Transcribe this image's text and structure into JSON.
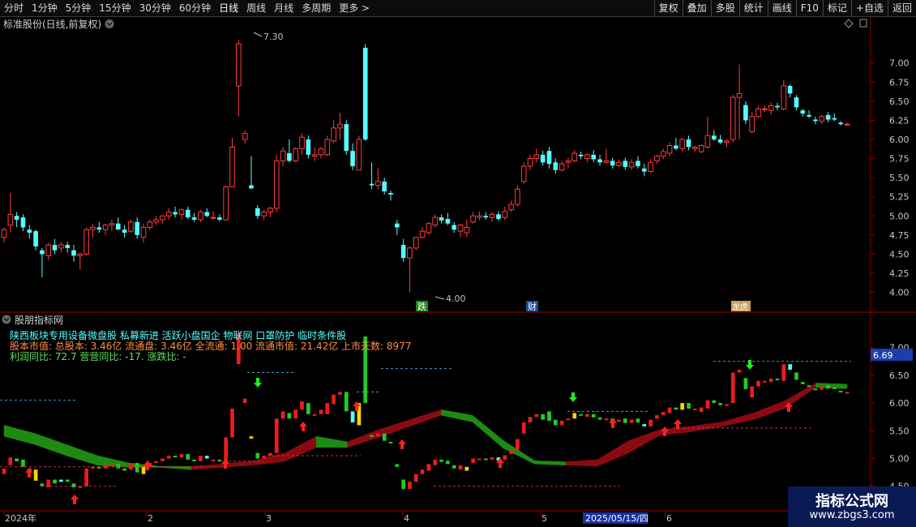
{
  "toolbar": {
    "periods": [
      "分时",
      "1分钟",
      "5分钟",
      "15分钟",
      "30分钟",
      "60分钟",
      "日线",
      "周线",
      "月线",
      "多周期",
      "更多 >"
    ],
    "active": "日线",
    "right_buttons": [
      "复权",
      "叠加",
      "多股",
      "统计",
      "画线",
      "F10",
      "标记",
      "+自选",
      "返回"
    ]
  },
  "main_panel": {
    "title": "标准股份(日线,前复权)",
    "high_label": "7.30",
    "low_label": "4.00",
    "markers": [
      "跌",
      "财",
      "龙虎"
    ],
    "y_ticks": [
      "7.00",
      "6.75",
      "6.50",
      "6.25",
      "6.00",
      "5.75",
      "5.50",
      "5.25",
      "5.00",
      "4.75",
      "4.50",
      "4.25",
      "4.00"
    ]
  },
  "indicator_panel": {
    "title": "股朋指标网",
    "line1": "陕西板块专用设备微盘股 私募新进 活跃小盘国企 物联网 口罩防护 临时条件股",
    "line2": "股本市值: 总股本: 3.46亿 流通盘: 3.46亿 全流通: 1.00 流通市值: 21.42亿 上市天数: 8977",
    "line3": "利润同比: 72.7 营营同比: -17. 涨跌比: -",
    "current_value": "6.69",
    "y_ticks": [
      "7.00",
      "6.50",
      "6.00",
      "5.50",
      "5.00",
      "4.50"
    ]
  },
  "x_axis": {
    "labels": [
      "2024年",
      "2",
      "3",
      "4",
      "5",
      "6"
    ],
    "cursor_date": "2025/05/15/四"
  },
  "watermark": {
    "title": "指标公式网",
    "url": "www.zbgs3.com"
  },
  "colors": {
    "up": "#ff3c3c",
    "down": "#54ffff",
    "bg": "#000000",
    "axis": "#8b0000"
  },
  "chart_data": {
    "type": "candlestick",
    "ylim": [
      3.9,
      7.4
    ],
    "candles": [
      {
        "o": 4.72,
        "h": 4.85,
        "l": 4.65,
        "c": 4.82
      },
      {
        "o": 4.88,
        "h": 5.3,
        "l": 4.78,
        "c": 5.02
      },
      {
        "o": 5.0,
        "h": 5.05,
        "l": 4.85,
        "c": 4.95
      },
      {
        "o": 4.98,
        "h": 5.02,
        "l": 4.8,
        "c": 4.85
      },
      {
        "o": 4.82,
        "h": 4.88,
        "l": 4.7,
        "c": 4.78
      },
      {
        "o": 4.8,
        "h": 4.82,
        "l": 4.55,
        "c": 4.6
      },
      {
        "o": 4.55,
        "h": 4.58,
        "l": 4.2,
        "c": 4.5
      },
      {
        "o": 4.48,
        "h": 4.65,
        "l": 4.42,
        "c": 4.62
      },
      {
        "o": 4.62,
        "h": 4.7,
        "l": 4.5,
        "c": 4.55
      },
      {
        "o": 4.58,
        "h": 4.66,
        "l": 4.52,
        "c": 4.62
      },
      {
        "o": 4.62,
        "h": 4.66,
        "l": 4.52,
        "c": 4.58
      },
      {
        "o": 4.55,
        "h": 4.62,
        "l": 4.4,
        "c": 4.48
      },
      {
        "o": 4.48,
        "h": 4.52,
        "l": 4.3,
        "c": 4.5
      },
      {
        "o": 4.5,
        "h": 4.85,
        "l": 4.48,
        "c": 4.82
      },
      {
        "o": 4.82,
        "h": 4.9,
        "l": 4.72,
        "c": 4.85
      },
      {
        "o": 4.85,
        "h": 4.92,
        "l": 4.78,
        "c": 4.82
      },
      {
        "o": 4.82,
        "h": 4.9,
        "l": 4.75,
        "c": 4.88
      },
      {
        "o": 4.88,
        "h": 4.95,
        "l": 4.8,
        "c": 4.9
      },
      {
        "o": 4.9,
        "h": 4.98,
        "l": 4.85,
        "c": 4.82
      },
      {
        "o": 4.82,
        "h": 4.88,
        "l": 4.72,
        "c": 4.78
      },
      {
        "o": 4.8,
        "h": 4.95,
        "l": 4.78,
        "c": 4.92
      },
      {
        "o": 4.92,
        "h": 4.98,
        "l": 4.7,
        "c": 4.75
      },
      {
        "o": 4.72,
        "h": 4.9,
        "l": 4.65,
        "c": 4.85
      },
      {
        "o": 4.85,
        "h": 4.95,
        "l": 4.82,
        "c": 4.92
      },
      {
        "o": 4.92,
        "h": 5.0,
        "l": 4.88,
        "c": 4.95
      },
      {
        "o": 4.95,
        "h": 5.0,
        "l": 4.9,
        "c": 5.0
      },
      {
        "o": 5.0,
        "h": 5.1,
        "l": 4.95,
        "c": 5.05
      },
      {
        "o": 5.05,
        "h": 5.12,
        "l": 4.98,
        "c": 5.02
      },
      {
        "o": 5.02,
        "h": 5.1,
        "l": 4.95,
        "c": 5.08
      },
      {
        "o": 5.08,
        "h": 5.12,
        "l": 4.96,
        "c": 4.98
      },
      {
        "o": 4.98,
        "h": 5.04,
        "l": 4.92,
        "c": 4.95
      },
      {
        "o": 4.95,
        "h": 5.08,
        "l": 4.92,
        "c": 5.05
      },
      {
        "o": 5.05,
        "h": 5.1,
        "l": 4.98,
        "c": 5.0
      },
      {
        "o": 4.98,
        "h": 5.06,
        "l": 4.94,
        "c": 4.98
      },
      {
        "o": 4.98,
        "h": 5.02,
        "l": 4.93,
        "c": 4.95
      },
      {
        "o": 4.95,
        "h": 5.4,
        "l": 4.93,
        "c": 5.38
      },
      {
        "o": 5.38,
        "h": 6.02,
        "l": 5.38,
        "c": 5.9
      },
      {
        "o": 6.7,
        "h": 7.3,
        "l": 6.3,
        "c": 7.25
      },
      {
        "o": 6.0,
        "h": 6.12,
        "l": 5.95,
        "c": 6.08
      },
      {
        "o": 5.4,
        "h": 5.78,
        "l": 5.35,
        "c": 5.36
      },
      {
        "o": 5.1,
        "h": 5.14,
        "l": 4.96,
        "c": 5.0
      },
      {
        "o": 5.0,
        "h": 5.08,
        "l": 4.95,
        "c": 5.05
      },
      {
        "o": 5.05,
        "h": 5.12,
        "l": 4.98,
        "c": 5.1
      },
      {
        "o": 5.1,
        "h": 5.8,
        "l": 5.05,
        "c": 5.72
      },
      {
        "o": 5.72,
        "h": 5.9,
        "l": 5.65,
        "c": 5.85
      },
      {
        "o": 5.82,
        "h": 6.0,
        "l": 5.7,
        "c": 5.72
      },
      {
        "o": 5.72,
        "h": 5.9,
        "l": 5.7,
        "c": 5.88
      },
      {
        "o": 5.88,
        "h": 6.08,
        "l": 5.8,
        "c": 6.03
      },
      {
        "o": 6.0,
        "h": 6.05,
        "l": 5.75,
        "c": 5.8
      },
      {
        "o": 5.78,
        "h": 5.9,
        "l": 5.72,
        "c": 5.8
      },
      {
        "o": 5.8,
        "h": 5.9,
        "l": 5.75,
        "c": 5.88
      },
      {
        "o": 5.8,
        "h": 6.05,
        "l": 5.78,
        "c": 6.0
      },
      {
        "o": 5.98,
        "h": 6.25,
        "l": 5.95,
        "c": 6.15
      },
      {
        "o": 6.15,
        "h": 6.35,
        "l": 6.0,
        "c": 6.2
      },
      {
        "o": 6.2,
        "h": 6.25,
        "l": 5.8,
        "c": 5.85
      },
      {
        "o": 5.85,
        "h": 5.95,
        "l": 5.6,
        "c": 5.65
      },
      {
        "o": 5.6,
        "h": 6.05,
        "l": 5.6,
        "c": 6.0
      },
      {
        "o": 7.2,
        "h": 7.25,
        "l": 5.98,
        "c": 6.0
      },
      {
        "o": 5.42,
        "h": 5.7,
        "l": 5.35,
        "c": 5.4
      },
      {
        "o": 5.4,
        "h": 5.62,
        "l": 5.35,
        "c": 5.45
      },
      {
        "o": 5.45,
        "h": 5.5,
        "l": 5.28,
        "c": 5.32
      },
      {
        "o": 5.3,
        "h": 5.33,
        "l": 5.2,
        "c": 5.28
      },
      {
        "o": 4.9,
        "h": 4.95,
        "l": 4.75,
        "c": 4.85
      },
      {
        "o": 4.62,
        "h": 4.7,
        "l": 4.4,
        "c": 4.45
      },
      {
        "o": 4.45,
        "h": 4.6,
        "l": 4.0,
        "c": 4.58
      },
      {
        "o": 4.58,
        "h": 4.7,
        "l": 4.55,
        "c": 4.72
      },
      {
        "o": 4.72,
        "h": 4.85,
        "l": 4.7,
        "c": 4.8
      },
      {
        "o": 4.78,
        "h": 4.92,
        "l": 4.75,
        "c": 4.9
      },
      {
        "o": 4.88,
        "h": 5.02,
        "l": 4.85,
        "c": 4.98
      },
      {
        "o": 4.98,
        "h": 5.02,
        "l": 4.9,
        "c": 4.94
      },
      {
        "o": 4.96,
        "h": 5.04,
        "l": 4.88,
        "c": 4.9
      },
      {
        "o": 4.88,
        "h": 4.92,
        "l": 4.78,
        "c": 4.82
      },
      {
        "o": 4.8,
        "h": 4.9,
        "l": 4.72,
        "c": 4.88
      },
      {
        "o": 4.78,
        "h": 4.95,
        "l": 4.72,
        "c": 4.85
      },
      {
        "o": 4.92,
        "h": 5.05,
        "l": 4.9,
        "c": 5.0
      },
      {
        "o": 4.98,
        "h": 5.06,
        "l": 4.94,
        "c": 5.0
      },
      {
        "o": 5.0,
        "h": 5.05,
        "l": 4.95,
        "c": 4.98
      },
      {
        "o": 4.98,
        "h": 5.05,
        "l": 4.92,
        "c": 5.02
      },
      {
        "o": 5.02,
        "h": 5.06,
        "l": 4.94,
        "c": 4.96
      },
      {
        "o": 4.98,
        "h": 5.12,
        "l": 4.95,
        "c": 5.06
      },
      {
        "o": 5.08,
        "h": 5.2,
        "l": 5.05,
        "c": 5.15
      },
      {
        "o": 5.15,
        "h": 5.4,
        "l": 5.12,
        "c": 5.35
      },
      {
        "o": 5.45,
        "h": 5.7,
        "l": 5.42,
        "c": 5.65
      },
      {
        "o": 5.65,
        "h": 5.8,
        "l": 5.6,
        "c": 5.75
      },
      {
        "o": 5.75,
        "h": 5.88,
        "l": 5.7,
        "c": 5.8
      },
      {
        "o": 5.8,
        "h": 5.85,
        "l": 5.66,
        "c": 5.7
      },
      {
        "o": 5.85,
        "h": 5.9,
        "l": 5.62,
        "c": 5.68
      },
      {
        "o": 5.7,
        "h": 5.75,
        "l": 5.55,
        "c": 5.6
      },
      {
        "o": 5.6,
        "h": 5.72,
        "l": 5.58,
        "c": 5.68
      },
      {
        "o": 5.7,
        "h": 5.76,
        "l": 5.62,
        "c": 5.72
      },
      {
        "o": 5.72,
        "h": 5.86,
        "l": 5.7,
        "c": 5.82
      },
      {
        "o": 5.8,
        "h": 5.84,
        "l": 5.74,
        "c": 5.78
      },
      {
        "o": 5.75,
        "h": 5.82,
        "l": 5.7,
        "c": 5.8
      },
      {
        "o": 5.8,
        "h": 5.86,
        "l": 5.7,
        "c": 5.74
      },
      {
        "o": 5.74,
        "h": 5.8,
        "l": 5.66,
        "c": 5.7
      },
      {
        "o": 5.7,
        "h": 5.88,
        "l": 5.68,
        "c": 5.72
      },
      {
        "o": 5.72,
        "h": 5.76,
        "l": 5.62,
        "c": 5.66
      },
      {
        "o": 5.66,
        "h": 5.74,
        "l": 5.64,
        "c": 5.7
      },
      {
        "o": 5.72,
        "h": 5.76,
        "l": 5.6,
        "c": 5.64
      },
      {
        "o": 5.64,
        "h": 5.74,
        "l": 5.6,
        "c": 5.7
      },
      {
        "o": 5.72,
        "h": 5.78,
        "l": 5.62,
        "c": 5.65
      },
      {
        "o": 5.62,
        "h": 5.68,
        "l": 5.52,
        "c": 5.58
      },
      {
        "o": 5.58,
        "h": 5.74,
        "l": 5.56,
        "c": 5.7
      },
      {
        "o": 5.72,
        "h": 5.8,
        "l": 5.68,
        "c": 5.78
      },
      {
        "o": 5.78,
        "h": 5.88,
        "l": 5.74,
        "c": 5.84
      },
      {
        "o": 5.82,
        "h": 5.96,
        "l": 5.78,
        "c": 5.92
      },
      {
        "o": 5.92,
        "h": 6.02,
        "l": 5.86,
        "c": 5.88
      },
      {
        "o": 5.88,
        "h": 6.02,
        "l": 5.84,
        "c": 6.0
      },
      {
        "o": 6.0,
        "h": 6.05,
        "l": 5.86,
        "c": 5.9
      },
      {
        "o": 5.88,
        "h": 5.92,
        "l": 5.84,
        "c": 5.9
      },
      {
        "o": 5.84,
        "h": 5.94,
        "l": 5.82,
        "c": 5.92
      },
      {
        "o": 5.9,
        "h": 6.3,
        "l": 5.88,
        "c": 6.05
      },
      {
        "o": 6.05,
        "h": 6.12,
        "l": 5.98,
        "c": 6.0
      },
      {
        "o": 6.0,
        "h": 6.06,
        "l": 5.94,
        "c": 5.96
      },
      {
        "o": 5.96,
        "h": 6.0,
        "l": 5.9,
        "c": 5.98
      },
      {
        "o": 6.0,
        "h": 6.58,
        "l": 5.96,
        "c": 6.55
      },
      {
        "o": 6.55,
        "h": 6.98,
        "l": 6.0,
        "c": 6.6
      },
      {
        "o": 6.45,
        "h": 6.5,
        "l": 6.2,
        "c": 6.25
      },
      {
        "o": 6.1,
        "h": 6.36,
        "l": 6.08,
        "c": 6.3
      },
      {
        "o": 6.3,
        "h": 6.44,
        "l": 6.28,
        "c": 6.4
      },
      {
        "o": 6.4,
        "h": 6.45,
        "l": 6.36,
        "c": 6.4
      },
      {
        "o": 6.38,
        "h": 6.48,
        "l": 6.32,
        "c": 6.44
      },
      {
        "o": 6.44,
        "h": 6.48,
        "l": 6.38,
        "c": 6.42
      },
      {
        "o": 6.4,
        "h": 6.78,
        "l": 6.38,
        "c": 6.7
      },
      {
        "o": 6.7,
        "h": 6.72,
        "l": 6.55,
        "c": 6.6
      },
      {
        "o": 6.55,
        "h": 6.58,
        "l": 6.38,
        "c": 6.42
      },
      {
        "o": 6.38,
        "h": 6.4,
        "l": 6.3,
        "c": 6.34
      },
      {
        "o": 6.32,
        "h": 6.38,
        "l": 6.28,
        "c": 6.3
      },
      {
        "o": 6.26,
        "h": 6.3,
        "l": 6.2,
        "c": 6.24
      },
      {
        "o": 6.24,
        "h": 6.32,
        "l": 6.2,
        "c": 6.3
      },
      {
        "o": 6.32,
        "h": 6.36,
        "l": 6.22,
        "c": 6.26
      },
      {
        "o": 6.28,
        "h": 6.34,
        "l": 6.24,
        "c": 6.26
      },
      {
        "o": 6.22,
        "h": 6.24,
        "l": 6.18,
        "c": 6.2
      },
      {
        "o": 6.2,
        "h": 6.22,
        "l": 6.18,
        "c": 6.2
      }
    ],
    "indicator_ylim": [
      4.35,
      7.2
    ],
    "ribbon": [
      {
        "a": 5.6,
        "b": 5.4
      },
      {
        "a": 5.45,
        "b": 5.25
      },
      {
        "a": 5.25,
        "b": 5.05
      },
      {
        "a": 5.05,
        "b": 4.88
      },
      {
        "a": 4.92,
        "b": 4.84
      },
      {
        "a": 4.86,
        "b": 4.84
      },
      {
        "a": 4.86,
        "b": 4.8
      },
      {
        "a": 4.9,
        "b": 4.84
      },
      {
        "a": 4.96,
        "b": 4.88
      },
      {
        "a": 5.1,
        "b": 4.95
      },
      {
        "a": 5.4,
        "b": 5.2
      },
      {
        "a": 5.3,
        "b": 5.2
      },
      {
        "a": 5.52,
        "b": 5.38
      },
      {
        "a": 5.7,
        "b": 5.58
      },
      {
        "a": 5.88,
        "b": 5.78
      },
      {
        "a": 5.78,
        "b": 5.66
      },
      {
        "a": 5.32,
        "b": 5.18
      },
      {
        "a": 4.96,
        "b": 4.9
      },
      {
        "a": 4.94,
        "b": 4.88
      },
      {
        "a": 4.98,
        "b": 4.86
      },
      {
        "a": 5.32,
        "b": 5.1
      },
      {
        "a": 5.52,
        "b": 5.42
      },
      {
        "a": 5.58,
        "b": 5.48
      },
      {
        "a": 5.66,
        "b": 5.58
      },
      {
        "a": 5.82,
        "b": 5.7
      },
      {
        "a": 6.04,
        "b": 5.9
      },
      {
        "a": 6.36,
        "b": 6.28
      },
      {
        "a": 6.34,
        "b": 6.26
      }
    ]
  }
}
